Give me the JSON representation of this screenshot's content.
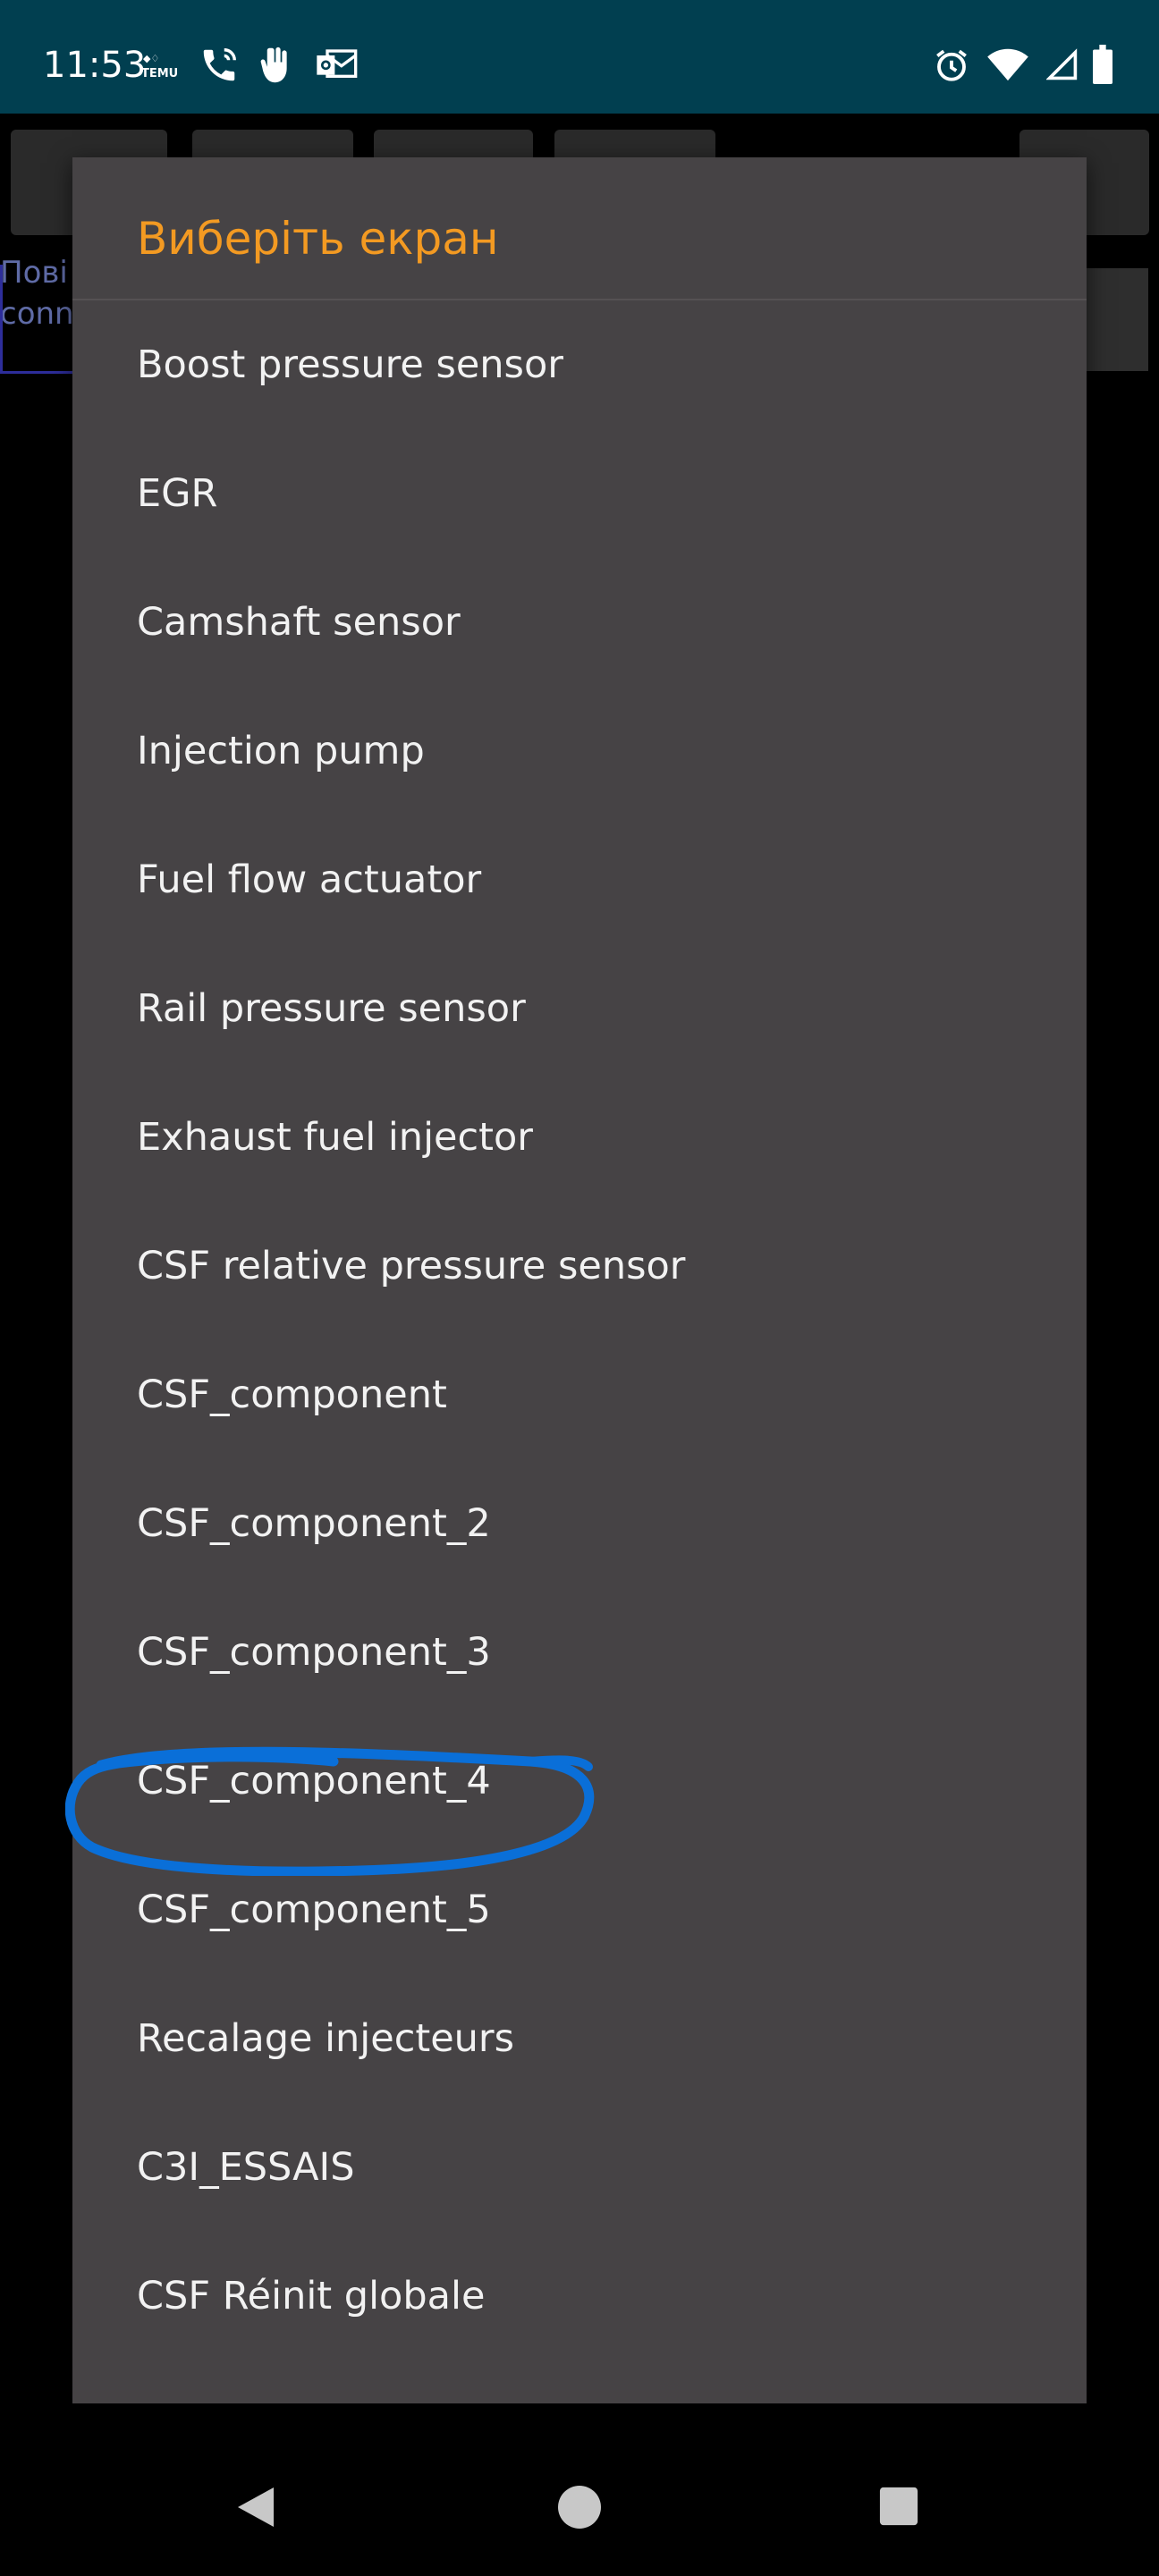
{
  "status_bar": {
    "time": "11:53",
    "notification_icons": [
      "temu-icon",
      "phone-call-icon",
      "hand-icon",
      "outlook-icon"
    ],
    "system_icons": [
      "alarm-icon",
      "wifi-icon",
      "signal-icon",
      "battery-icon"
    ]
  },
  "background": {
    "text_line1": "Пові",
    "text_line2": "conn"
  },
  "dialog": {
    "title": "Виберіть екран",
    "items": [
      "Boost pressure sensor",
      "EGR",
      "Camshaft sensor",
      "Injection pump",
      "Fuel flow actuator",
      "Rail pressure sensor",
      "Exhaust fuel injector",
      "CSF relative pressure sensor",
      "CSF_component",
      "CSF_component_2",
      "CSF_component_3",
      "CSF_component_4",
      "CSF_component_5",
      "Recalage injecteurs",
      "C3I_ESSAIS",
      "CSF Réinit globale"
    ],
    "highlighted_item": "CSF_component_4"
  },
  "nav_bar": {
    "buttons": [
      "back-icon",
      "home-icon",
      "recents-icon"
    ]
  },
  "colors": {
    "status_bar_bg": "#013f50",
    "dialog_bg": "#464345",
    "title_accent": "#f39a22",
    "annotation_ring": "#0a6fd8"
  }
}
